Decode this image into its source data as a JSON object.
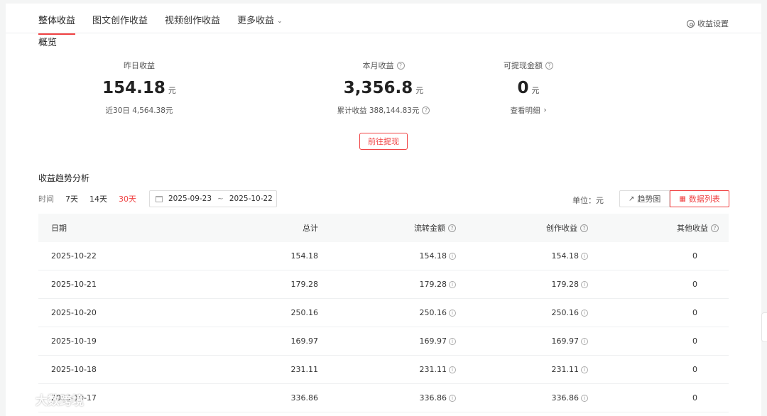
{
  "tabs": [
    {
      "label": "整体收益",
      "active": true
    },
    {
      "label": "图文创作收益",
      "active": false
    },
    {
      "label": "视频创作收益",
      "active": false
    },
    {
      "label": "更多收益",
      "active": false
    }
  ],
  "settings_label": "收益设置",
  "overview": {
    "title": "概览",
    "yesterday": {
      "label": "昨日收益",
      "value": "154.18",
      "unit": "元",
      "sub": "近30日 4,564.38元"
    },
    "month": {
      "label": "本月收益",
      "value": "3,356.8",
      "unit": "元",
      "sub": "累计收益 388,144.83元"
    },
    "withdrawable": {
      "label": "可提现金额",
      "value": "0",
      "unit": "元",
      "sub": "查看明细"
    }
  },
  "withdraw_button": "前往提现",
  "trend": {
    "title": "收益趋势分析",
    "time_label": "时间",
    "ranges": [
      {
        "label": "7天",
        "active": false
      },
      {
        "label": "14天",
        "active": false
      },
      {
        "label": "30天",
        "active": true
      }
    ],
    "date_start": "2025-09-23",
    "date_sep": "~",
    "date_end": "2025-10-22",
    "unit_label": "单位：元",
    "view_chart": "趋势图",
    "view_list": "数据列表"
  },
  "table": {
    "headers": [
      "日期",
      "总计",
      "流转金额",
      "创作收益",
      "其他收益"
    ],
    "rows": [
      [
        "2025-10-22",
        "154.18",
        "154.18",
        "154.18",
        "0"
      ],
      [
        "2025-10-21",
        "179.28",
        "179.28",
        "179.28",
        "0"
      ],
      [
        "2025-10-20",
        "250.16",
        "250.16",
        "250.16",
        "0"
      ],
      [
        "2025-10-19",
        "169.97",
        "169.97",
        "169.97",
        "0"
      ],
      [
        "2025-10-18",
        "231.11",
        "231.11",
        "231.11",
        "0"
      ],
      [
        "2025-10-17",
        "336.86",
        "336.86",
        "336.86",
        "0"
      ]
    ]
  },
  "watermark": "大数跨境",
  "colors": {
    "accent": "#f04142",
    "header_bg": "#f7f8f8",
    "page_bg": "#f4f5f5"
  }
}
